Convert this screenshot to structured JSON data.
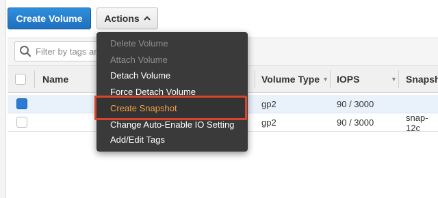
{
  "toolbar": {
    "create_volume_label": "Create Volume",
    "actions_label": "Actions",
    "actions_caret": "^"
  },
  "search": {
    "placeholder": "Filter by tags and attributes or search by keyword"
  },
  "table": {
    "columns": {
      "name": "Name",
      "volume_type": "Volume Type",
      "iops": "IOPS",
      "snapshot": "Snapshot"
    },
    "rows": [
      {
        "selected": true,
        "volume_type": "gp2",
        "iops": "90 / 3000",
        "snapshot": ""
      },
      {
        "selected": false,
        "volume_type": "gp2",
        "iops": "90 / 3000",
        "snapshot": "snap-12c"
      }
    ]
  },
  "actions_menu": {
    "items": [
      {
        "label": "Delete Volume",
        "state": "disabled"
      },
      {
        "label": "Attach Volume",
        "state": "disabled"
      },
      {
        "label": "Detach Volume",
        "state": "enabled"
      },
      {
        "label": "Force Detach Volume",
        "state": "enabled"
      },
      {
        "label": "Create Snapshot",
        "state": "highlighted"
      },
      {
        "label": "Change Auto-Enable IO Setting",
        "state": "enabled"
      },
      {
        "label": "Add/Edit Tags",
        "state": "enabled"
      }
    ]
  },
  "colors": {
    "primary_button": "#1f6fbf",
    "menu_background": "#3a3a3a",
    "menu_highlight_text": "#f0a049",
    "annotation_border": "#d9452b",
    "selected_row": "#e9f1fb"
  }
}
